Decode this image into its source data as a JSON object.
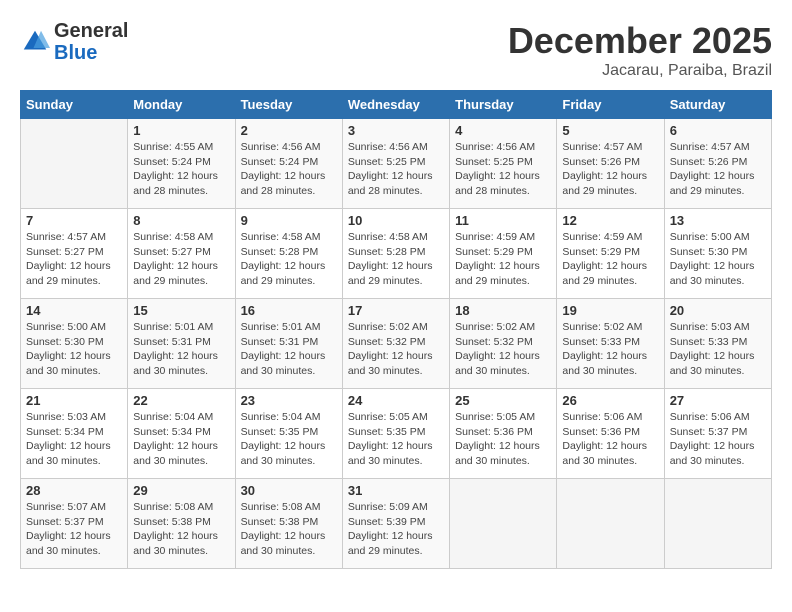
{
  "header": {
    "logo_general": "General",
    "logo_blue": "Blue",
    "month_title": "December 2025",
    "location": "Jacarau, Paraiba, Brazil"
  },
  "days_of_week": [
    "Sunday",
    "Monday",
    "Tuesday",
    "Wednesday",
    "Thursday",
    "Friday",
    "Saturday"
  ],
  "weeks": [
    [
      {
        "day": "",
        "info": ""
      },
      {
        "day": "1",
        "info": "Sunrise: 4:55 AM\nSunset: 5:24 PM\nDaylight: 12 hours\nand 28 minutes."
      },
      {
        "day": "2",
        "info": "Sunrise: 4:56 AM\nSunset: 5:24 PM\nDaylight: 12 hours\nand 28 minutes."
      },
      {
        "day": "3",
        "info": "Sunrise: 4:56 AM\nSunset: 5:25 PM\nDaylight: 12 hours\nand 28 minutes."
      },
      {
        "day": "4",
        "info": "Sunrise: 4:56 AM\nSunset: 5:25 PM\nDaylight: 12 hours\nand 28 minutes."
      },
      {
        "day": "5",
        "info": "Sunrise: 4:57 AM\nSunset: 5:26 PM\nDaylight: 12 hours\nand 29 minutes."
      },
      {
        "day": "6",
        "info": "Sunrise: 4:57 AM\nSunset: 5:26 PM\nDaylight: 12 hours\nand 29 minutes."
      }
    ],
    [
      {
        "day": "7",
        "info": "Sunrise: 4:57 AM\nSunset: 5:27 PM\nDaylight: 12 hours\nand 29 minutes."
      },
      {
        "day": "8",
        "info": "Sunrise: 4:58 AM\nSunset: 5:27 PM\nDaylight: 12 hours\nand 29 minutes."
      },
      {
        "day": "9",
        "info": "Sunrise: 4:58 AM\nSunset: 5:28 PM\nDaylight: 12 hours\nand 29 minutes."
      },
      {
        "day": "10",
        "info": "Sunrise: 4:58 AM\nSunset: 5:28 PM\nDaylight: 12 hours\nand 29 minutes."
      },
      {
        "day": "11",
        "info": "Sunrise: 4:59 AM\nSunset: 5:29 PM\nDaylight: 12 hours\nand 29 minutes."
      },
      {
        "day": "12",
        "info": "Sunrise: 4:59 AM\nSunset: 5:29 PM\nDaylight: 12 hours\nand 29 minutes."
      },
      {
        "day": "13",
        "info": "Sunrise: 5:00 AM\nSunset: 5:30 PM\nDaylight: 12 hours\nand 30 minutes."
      }
    ],
    [
      {
        "day": "14",
        "info": "Sunrise: 5:00 AM\nSunset: 5:30 PM\nDaylight: 12 hours\nand 30 minutes."
      },
      {
        "day": "15",
        "info": "Sunrise: 5:01 AM\nSunset: 5:31 PM\nDaylight: 12 hours\nand 30 minutes."
      },
      {
        "day": "16",
        "info": "Sunrise: 5:01 AM\nSunset: 5:31 PM\nDaylight: 12 hours\nand 30 minutes."
      },
      {
        "day": "17",
        "info": "Sunrise: 5:02 AM\nSunset: 5:32 PM\nDaylight: 12 hours\nand 30 minutes."
      },
      {
        "day": "18",
        "info": "Sunrise: 5:02 AM\nSunset: 5:32 PM\nDaylight: 12 hours\nand 30 minutes."
      },
      {
        "day": "19",
        "info": "Sunrise: 5:02 AM\nSunset: 5:33 PM\nDaylight: 12 hours\nand 30 minutes."
      },
      {
        "day": "20",
        "info": "Sunrise: 5:03 AM\nSunset: 5:33 PM\nDaylight: 12 hours\nand 30 minutes."
      }
    ],
    [
      {
        "day": "21",
        "info": "Sunrise: 5:03 AM\nSunset: 5:34 PM\nDaylight: 12 hours\nand 30 minutes."
      },
      {
        "day": "22",
        "info": "Sunrise: 5:04 AM\nSunset: 5:34 PM\nDaylight: 12 hours\nand 30 minutes."
      },
      {
        "day": "23",
        "info": "Sunrise: 5:04 AM\nSunset: 5:35 PM\nDaylight: 12 hours\nand 30 minutes."
      },
      {
        "day": "24",
        "info": "Sunrise: 5:05 AM\nSunset: 5:35 PM\nDaylight: 12 hours\nand 30 minutes."
      },
      {
        "day": "25",
        "info": "Sunrise: 5:05 AM\nSunset: 5:36 PM\nDaylight: 12 hours\nand 30 minutes."
      },
      {
        "day": "26",
        "info": "Sunrise: 5:06 AM\nSunset: 5:36 PM\nDaylight: 12 hours\nand 30 minutes."
      },
      {
        "day": "27",
        "info": "Sunrise: 5:06 AM\nSunset: 5:37 PM\nDaylight: 12 hours\nand 30 minutes."
      }
    ],
    [
      {
        "day": "28",
        "info": "Sunrise: 5:07 AM\nSunset: 5:37 PM\nDaylight: 12 hours\nand 30 minutes."
      },
      {
        "day": "29",
        "info": "Sunrise: 5:08 AM\nSunset: 5:38 PM\nDaylight: 12 hours\nand 30 minutes."
      },
      {
        "day": "30",
        "info": "Sunrise: 5:08 AM\nSunset: 5:38 PM\nDaylight: 12 hours\nand 30 minutes."
      },
      {
        "day": "31",
        "info": "Sunrise: 5:09 AM\nSunset: 5:39 PM\nDaylight: 12 hours\nand 29 minutes."
      },
      {
        "day": "",
        "info": ""
      },
      {
        "day": "",
        "info": ""
      },
      {
        "day": "",
        "info": ""
      }
    ]
  ]
}
